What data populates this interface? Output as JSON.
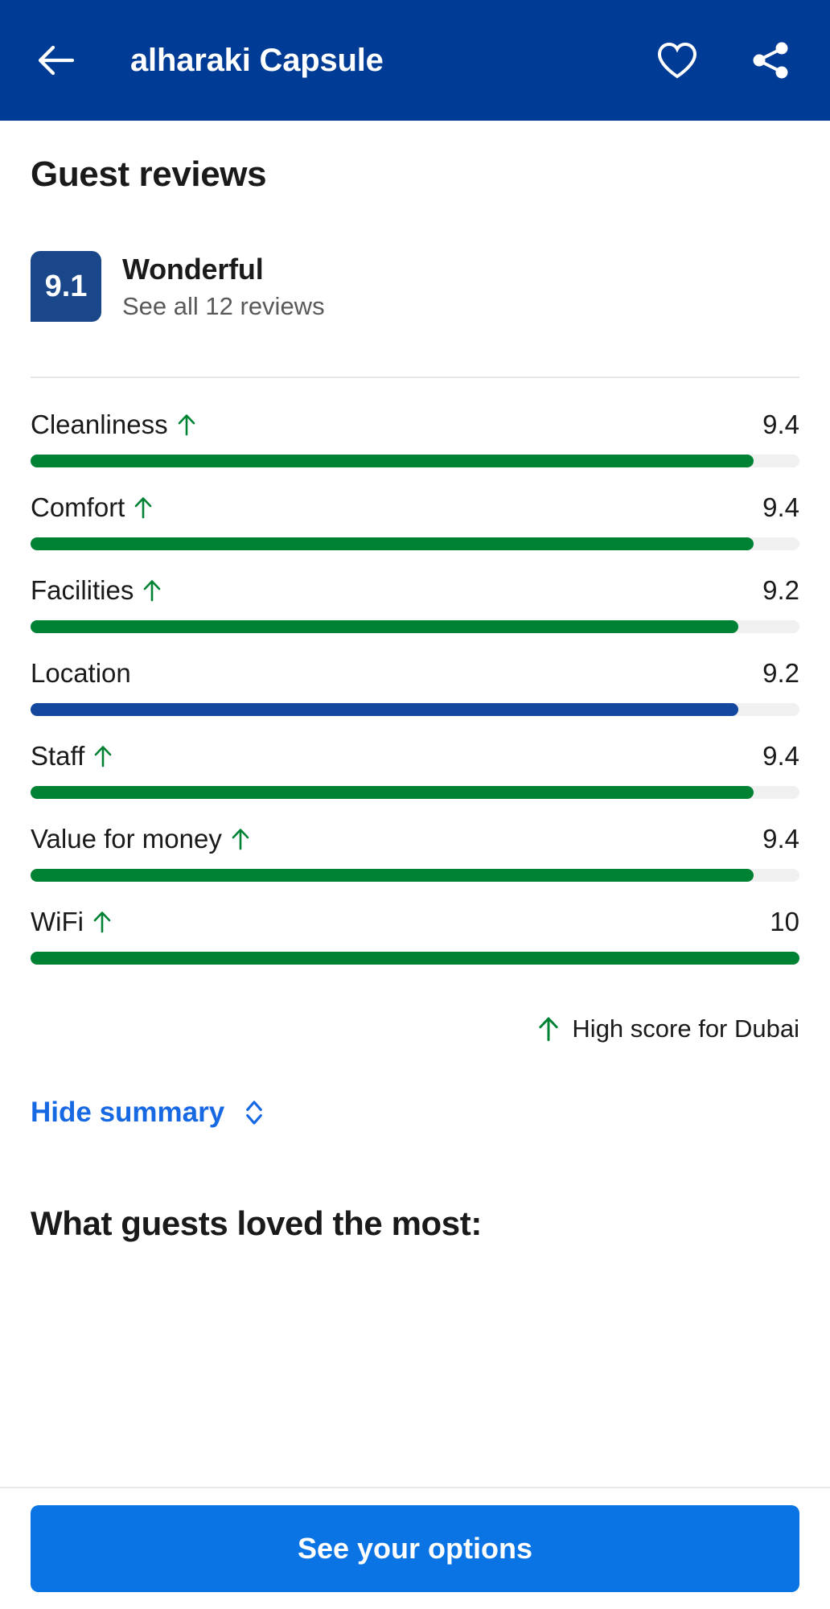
{
  "header": {
    "title": "alharaki Capsule",
    "back_icon": "arrow-left-icon",
    "favorite_icon": "heart-icon",
    "share_icon": "share-icon",
    "background_color": "#003b95"
  },
  "reviews": {
    "section_title": "Guest reviews",
    "score": "9.1",
    "score_word": "Wonderful",
    "see_all_label": "See all 12 reviews",
    "badge_color": "#1a4789"
  },
  "chart_data": {
    "type": "bar",
    "title": "Guest review category scores",
    "orientation": "horizontal",
    "xlim": [
      0,
      10
    ],
    "categories": [
      "Cleanliness",
      "Comfort",
      "Facilities",
      "Location",
      "Staff",
      "Value for money",
      "WiFi"
    ],
    "values": [
      9.4,
      9.4,
      9.2,
      9.2,
      9.4,
      9.4,
      10
    ],
    "value_labels": [
      "9.4",
      "9.4",
      "9.2",
      "9.2",
      "9.4",
      "9.4",
      "10"
    ],
    "bar_colors": [
      "#008234",
      "#008234",
      "#008234",
      "#13489e",
      "#008234",
      "#008234",
      "#008234"
    ],
    "high_score_flags": [
      true,
      true,
      true,
      false,
      true,
      true,
      true
    ],
    "track_color": "#f0f0f0",
    "grid": false,
    "legend": "High score for Dubai"
  },
  "rows": [
    {
      "label": "Cleanliness",
      "value": "9.4",
      "pct": 94,
      "color": "green",
      "high": true
    },
    {
      "label": "Comfort",
      "value": "9.4",
      "pct": 94,
      "color": "green",
      "high": true
    },
    {
      "label": "Facilities",
      "value": "9.2",
      "pct": 92,
      "color": "green",
      "high": true
    },
    {
      "label": "Location",
      "value": "9.2",
      "pct": 92,
      "color": "blue",
      "high": false
    },
    {
      "label": "Staff",
      "value": "9.4",
      "pct": 94,
      "color": "green",
      "high": true
    },
    {
      "label": "Value for money",
      "value": "9.4",
      "pct": 94,
      "color": "green",
      "high": true
    },
    {
      "label": "WiFi",
      "value": "10",
      "pct": 100,
      "color": "green",
      "high": true
    }
  ],
  "legend": {
    "icon": "arrow-up-icon",
    "text": "High score for Dubai",
    "color": "#008234"
  },
  "hide_summary": {
    "label": "Hide summary",
    "icon": "chevron-up-down-icon",
    "color": "#1668e3"
  },
  "loved": {
    "title": "What guests loved the most:"
  },
  "footer": {
    "cta_label": "See your options",
    "cta_color": "#0b74e5"
  }
}
